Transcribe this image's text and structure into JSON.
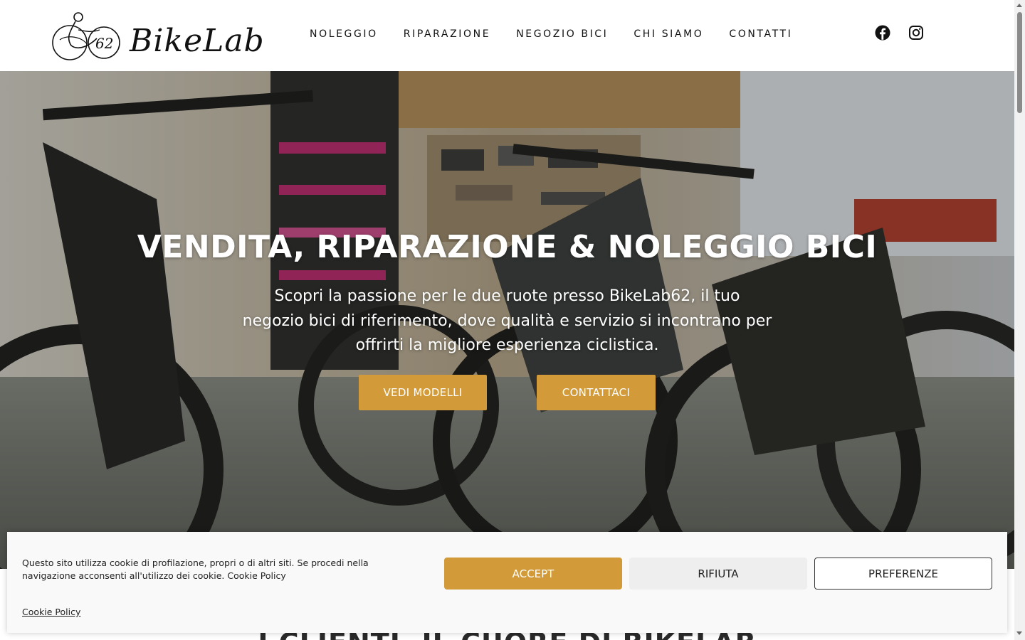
{
  "brand": {
    "logo_text": "BikeLab",
    "logo_number": "62"
  },
  "nav": {
    "items": [
      {
        "label": "NOLEGGIO"
      },
      {
        "label": "RIPARAZIONE"
      },
      {
        "label": "NEGOZIO BICI"
      },
      {
        "label": "CHI SIAMO"
      },
      {
        "label": "CONTATTI"
      }
    ]
  },
  "social": {
    "icons": [
      "facebook-icon",
      "instagram-icon"
    ]
  },
  "hero": {
    "title": "VENDITA, RIPARAZIONE & NOLEGGIO BICI",
    "subtitle": "Scopri la passione per le due ruote presso BikeLab62, il tuo negozio bici di riferimento, dove qualità e servizio si incontrano per offrirti la migliore esperienza ciclistica.",
    "btn_models": "VEDI MODELLI",
    "btn_contact": "CONTATTACI"
  },
  "section": {
    "title": "I CLIENTI, IL CUORE DI BIKELAB"
  },
  "cookie": {
    "text": "Questo sito utilizza cookie di profilazione, propri o di altri siti. Se procedi nella navigazione acconsenti all'utilizzo dei cookie. Cookie Policy",
    "link": "Cookie Policy",
    "accept": "ACCEPT",
    "reject": "RIFIUTA",
    "preferences": "PREFERENZE"
  },
  "colors": {
    "accent": "#d29a38",
    "nav_text": "#111111",
    "cookie_bg": "#f9f9f9"
  }
}
